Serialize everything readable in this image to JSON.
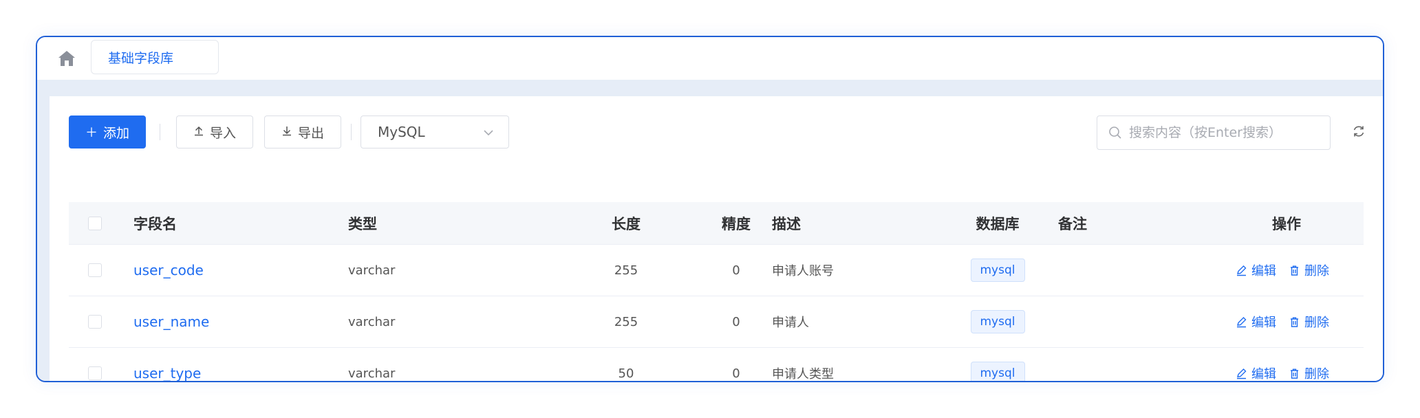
{
  "tabs": {
    "active": "基础字段库"
  },
  "toolbar": {
    "add_label": "添加",
    "import_label": "导入",
    "export_label": "导出",
    "db_select": "MySQL",
    "search_placeholder": "搜索内容（按Enter搜索）"
  },
  "table": {
    "headers": {
      "field_name": "字段名",
      "type": "类型",
      "length": "长度",
      "precision": "精度",
      "description": "描述",
      "database": "数据库",
      "remark": "备注",
      "actions": "操作"
    },
    "rows": [
      {
        "field_name": "user_code",
        "type": "varchar",
        "length": "255",
        "precision": "0",
        "description": "申请人账号",
        "database": "mysql",
        "remark": ""
      },
      {
        "field_name": "user_name",
        "type": "varchar",
        "length": "255",
        "precision": "0",
        "description": "申请人",
        "database": "mysql",
        "remark": ""
      },
      {
        "field_name": "user_type",
        "type": "varchar",
        "length": "50",
        "precision": "0",
        "description": "申请人类型",
        "database": "mysql",
        "remark": ""
      }
    ],
    "edit_label": "编辑",
    "delete_label": "删除"
  },
  "colors": {
    "primary": "#1f6cf0",
    "frame_border": "#1f5fd6",
    "band": "#e6edf7"
  },
  "icons": [
    "home-icon",
    "plus-icon",
    "upload-icon",
    "download-icon",
    "chevron-down-icon",
    "search-icon",
    "refresh-icon",
    "edit-icon",
    "trash-icon"
  ]
}
